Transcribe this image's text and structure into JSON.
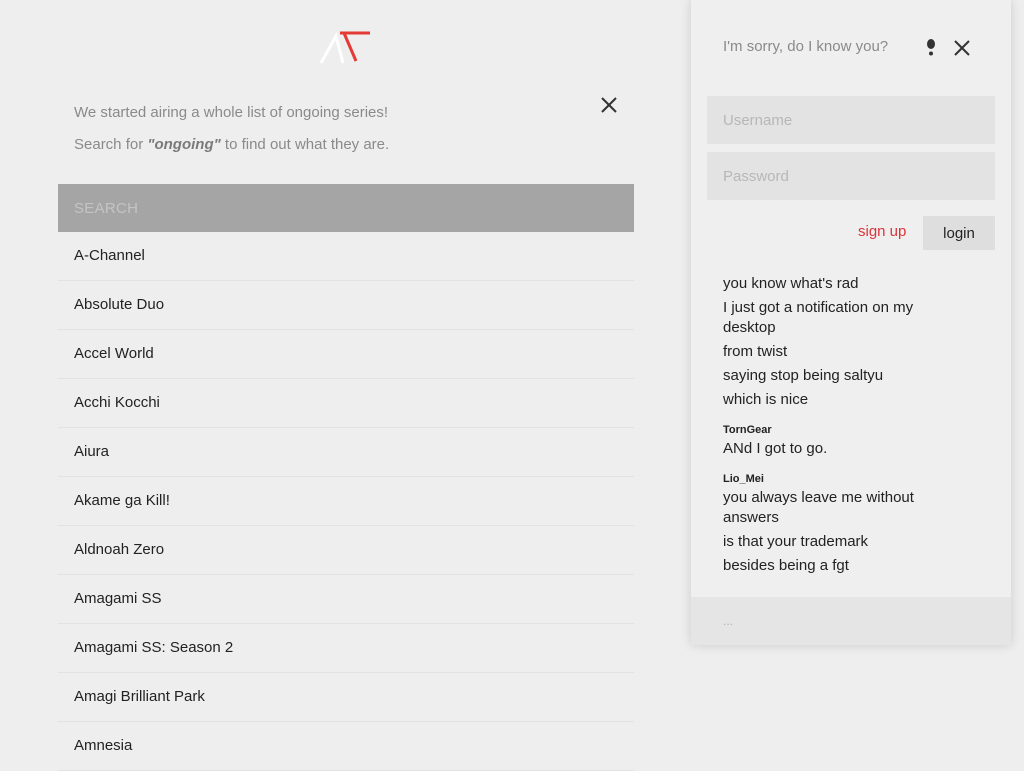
{
  "brand": {
    "logo_icon": "anime-logo",
    "accent": "#e53935"
  },
  "notice": {
    "line1": "We started airing a whole list of ongoing series!",
    "line2_prefix": "Search for ",
    "line2_keyword": "\"ongoing\"",
    "line2_suffix": " to find out what they are."
  },
  "search": {
    "placeholder": "SEARCH"
  },
  "series": [
    "A-Channel",
    "Absolute Duo",
    "Accel World",
    "Acchi Kocchi",
    "Aiura",
    "Akame ga Kill!",
    "Aldnoah Zero",
    "Amagami SS",
    "Amagami SS: Season 2",
    "Amagi Brilliant Park",
    "Amnesia"
  ],
  "panel": {
    "title": "I'm sorry, do I know you?",
    "username_placeholder": "Username",
    "password_placeholder": "Password",
    "signup_label": "sign up",
    "login_label": "login"
  },
  "chat": {
    "scroll_mark": ",",
    "groups": [
      {
        "author": "",
        "lines": [
          "you know what's rad",
          "I just got a notification on my desktop",
          "from twist",
          "saying stop being saltyu",
          "which is nice"
        ]
      },
      {
        "author": "TornGear",
        "lines": [
          "ANd I got to go."
        ]
      },
      {
        "author": "Lio_Mei",
        "lines": [
          "you always leave me without answers",
          "is that your trademark",
          "besides being a fgt"
        ]
      }
    ],
    "input_placeholder": "..."
  }
}
